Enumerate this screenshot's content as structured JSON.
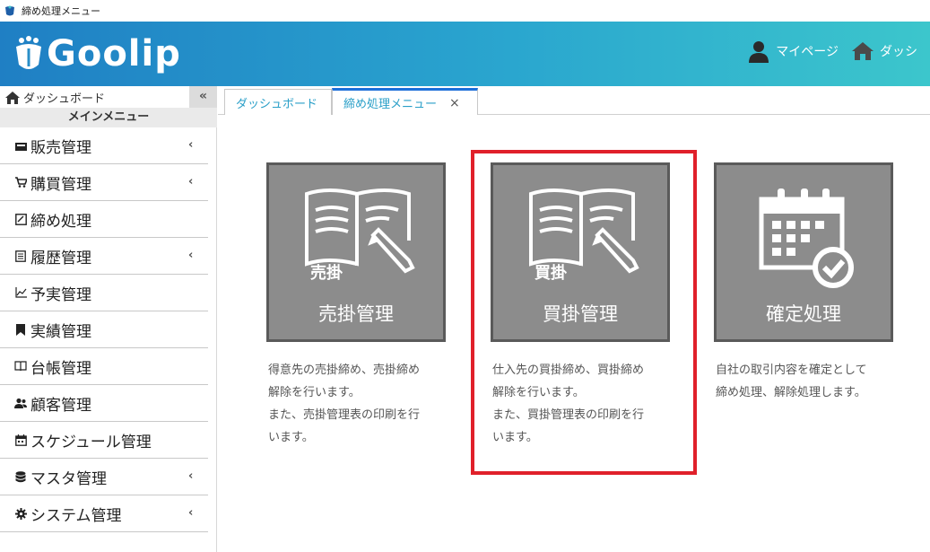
{
  "window": {
    "title": "締め処理メニュー"
  },
  "header": {
    "logo_text": "Goolip",
    "links": [
      {
        "label": "マイページ",
        "icon": "user-icon"
      },
      {
        "label": "ダッシ",
        "icon": "home-icon"
      }
    ]
  },
  "sidebar": {
    "dashboard_label": "ダッシュボード",
    "collapse_label": "«",
    "main_menu_label": "メインメニュー",
    "items": [
      {
        "label": "販売管理",
        "icon": "register-icon",
        "has_submenu": true
      },
      {
        "label": "購買管理",
        "icon": "cart-icon",
        "has_submenu": true
      },
      {
        "label": "締め処理",
        "icon": "checkbox-icon",
        "has_submenu": false
      },
      {
        "label": "履歴管理",
        "icon": "list-icon",
        "has_submenu": true
      },
      {
        "label": "予実管理",
        "icon": "chart-icon",
        "has_submenu": false
      },
      {
        "label": "実績管理",
        "icon": "bookmark-icon",
        "has_submenu": false
      },
      {
        "label": "台帳管理",
        "icon": "book-icon",
        "has_submenu": false
      },
      {
        "label": "顧客管理",
        "icon": "users-icon",
        "has_submenu": false
      },
      {
        "label": "スケジュール管理",
        "icon": "calendar-icon",
        "has_submenu": false
      },
      {
        "label": "マスタ管理",
        "icon": "database-icon",
        "has_submenu": true
      },
      {
        "label": "システム管理",
        "icon": "gear-icon",
        "has_submenu": true
      }
    ],
    "chevron": "‹"
  },
  "tabs": [
    {
      "label": "ダッシュボード",
      "active": false
    },
    {
      "label": "締め処理メニュー",
      "active": true,
      "close": "×"
    }
  ],
  "cards": [
    {
      "title": "売掛管理",
      "badge": "売掛",
      "icon": "book-pencil-icon",
      "description": [
        "得意先の売掛締め、売掛締め",
        "解除を行います。",
        "また、売掛管理表の印刷を行",
        "います。"
      ]
    },
    {
      "title": "買掛管理",
      "badge": "買掛",
      "icon": "book-pencil-icon",
      "description": [
        "仕入先の買掛締め、買掛締め",
        "解除を行います。",
        "また、買掛管理表の印刷を行",
        "います。"
      ]
    },
    {
      "title": "確定処理",
      "badge": "",
      "icon": "calendar-check-icon",
      "description": [
        "自社の取引内容を確定として",
        "締め処理、解除処理します。"
      ]
    }
  ],
  "colors": {
    "header_start": "#1f7fc4",
    "header_end": "#3cc6cc",
    "card_bg": "#8c8c8c",
    "highlight": "#e0202a",
    "tab_text": "#2a9fc8",
    "active_tab_border": "#1e6fd9"
  }
}
